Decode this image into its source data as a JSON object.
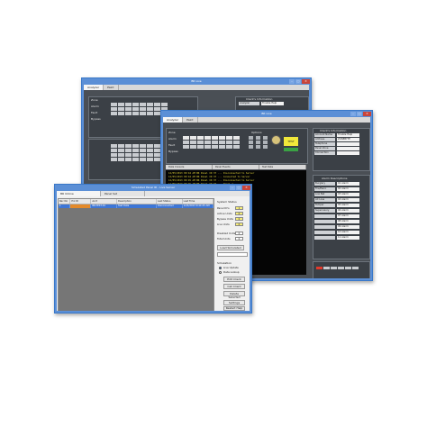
{
  "back_window": {
    "title": "BR Live",
    "tabs": [
      "Analyzer",
      "Paint"
    ],
    "panel_title": "Client's Information",
    "field_label": "Analyzer",
    "field_value": "Trouble Help",
    "row_labels": [
      "Zone",
      "Alarm",
      "Fault",
      "Bypass"
    ]
  },
  "mid_window": {
    "title": "BR Live",
    "tabs": [
      "Analyzer",
      "Paint"
    ],
    "row_labels": [
      "Zone",
      "Alarm",
      "Fault",
      "Bypass"
    ],
    "options_label": "Options",
    "client_info_title": "Client's Information",
    "client_fields": [
      {
        "k": "Account Name",
        "v": "Trouble Help"
      },
      {
        "k": "Address",
        "v": "ZONEBYTE"
      },
      {
        "k": "Telephone",
        "v": ""
      },
      {
        "k": "Panel Zone",
        "v": ""
      },
      {
        "k": "Connection",
        "v": ""
      }
    ],
    "console_tabs": [
      "Data Console",
      "Panel Events",
      "Test Data"
    ],
    "log_lines": [
      "12/05/2013 09:44 AM  BR Panel ID 37  ...  Disconnected to Server",
      "12/05/2013 09:44 AM  BR Panel ID 37  ...  Connected to Server",
      "12/05/2013 09:45 AM  BR Panel ID 37  ...  Disconnected to Server",
      "12/05/2013 09:45 AM  BR Panel ID 37  ...  Panel 1",
      "12/05/2013 09:45 AM  BR Panel ID 37  ...  Panel 2",
      "12/05/2013 09:46 AM  BR Panel ID 37  ...  Panel 3",
      "12/05/2013 09:46 AM  BR Panel ID 37  ...  Panel 4",
      "12/05/2013 09:46 AM  BR Panel ID 37  ...  Panel 5",
      "12/05/2013 09:47 AM  BR Panel ID 37  ...  Panel 6"
    ],
    "alarm_panel_title": "Alarm Descriptions",
    "alarm_fields": [
      {
        "k": "Burglary",
        "v": "01 Alarm"
      },
      {
        "k": "Fire/Panic",
        "v": "02 Alarm"
      },
      {
        "k": "Low Bat",
        "v": "03 Alarm"
      },
      {
        "k": "AC Loss",
        "v": "04 Alarm"
      },
      {
        "k": "Tamper",
        "v": "05 Alarm"
      },
      {
        "k": "Supervisory",
        "v": "06 Alarm"
      },
      {
        "k": "",
        "v": "07 Alarm"
      },
      {
        "k": "",
        "v": "08 Alarm"
      },
      {
        "k": "",
        "v": "09 Alarm"
      },
      {
        "k": "",
        "v": "10 Alarm"
      },
      {
        "k": "",
        "v": "11 Alarm"
      }
    ],
    "indicator_label": "TEST"
  },
  "front_window": {
    "title": "Simulated Panel ID - Live Server",
    "tabs": [
      "BR Online",
      "Panel Set"
    ],
    "columns": [
      "Rec No",
      "Pnl ID",
      "Acct",
      "Description",
      "Last Status",
      "Last Time"
    ],
    "rows": [
      {
        "rec": "1",
        "pnl": "",
        "acct": "BR-TEST-01",
        "desc": "Test Data",
        "status": "Disconnected",
        "time": "12/5/2013 9:44:25 AM"
      }
    ],
    "status_title": "System Status",
    "status_items": [
      {
        "label": "Panel ID's",
        "value": "1"
      },
      {
        "label": "Active Units",
        "value": "0"
      },
      {
        "label": "Bypass Units",
        "value": "0"
      },
      {
        "label": "Live Units",
        "value": "0"
      }
    ],
    "disabled_label": "Disabled Units",
    "disabled_value": "0",
    "uptime_label": "Total Units",
    "uptime_value": "0",
    "load_button": "Load Simulated",
    "simulation_label": "Simulation",
    "radio_options": [
      "Live Update",
      "Data Lookup"
    ],
    "buttons": [
      "Edit Client",
      "Call Client",
      "Delete Selected",
      "Settings",
      "Restart Help"
    ]
  }
}
